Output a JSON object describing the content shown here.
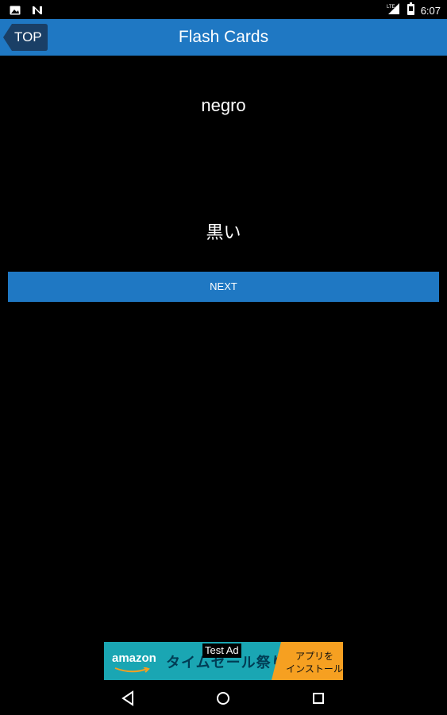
{
  "status_bar": {
    "time": "6:07",
    "icons": [
      "image-icon",
      "n-app-icon",
      "signal-lte-icon",
      "battery-icon"
    ]
  },
  "header": {
    "back_label": "TOP",
    "title": "Flash Cards",
    "color": "#1f78c3"
  },
  "card": {
    "front": "negro",
    "back": "黒い"
  },
  "next_button": {
    "label": "NEXT",
    "color": "#1f78c3"
  },
  "ad": {
    "brand": "amazon",
    "text": "タイムセール祭り",
    "cta_line1": "アプリを",
    "cta_line2": "インストール",
    "badge": "Test Ad",
    "bg_color": "#1aa6b3",
    "cta_color": "#f6a021"
  },
  "nav_bar": {
    "icons": [
      "back-triangle-icon",
      "home-circle-icon",
      "recents-square-icon"
    ]
  }
}
